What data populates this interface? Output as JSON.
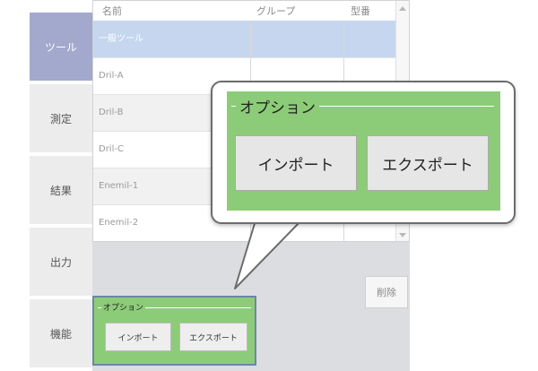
{
  "nav": {
    "items": [
      {
        "label": "ツール"
      },
      {
        "label": "測定"
      },
      {
        "label": "結果"
      },
      {
        "label": "出力"
      },
      {
        "label": "機能"
      }
    ]
  },
  "table": {
    "columns": [
      "名前",
      "グループ",
      "型番"
    ],
    "rows": [
      {
        "name": "一般ツール"
      },
      {
        "name": "Dril-A"
      },
      {
        "name": "Dril-B"
      },
      {
        "name": "Dril-C"
      },
      {
        "name": "Enemil-1"
      },
      {
        "name": "Enemil-2"
      }
    ]
  },
  "delete_label": "削除",
  "small_options": {
    "legend": "オプション",
    "import_label": "インポート",
    "export_label": "エクスポート"
  },
  "callout": {
    "legend": "オプション",
    "import_label": "インポート",
    "export_label": "エクスポート"
  }
}
